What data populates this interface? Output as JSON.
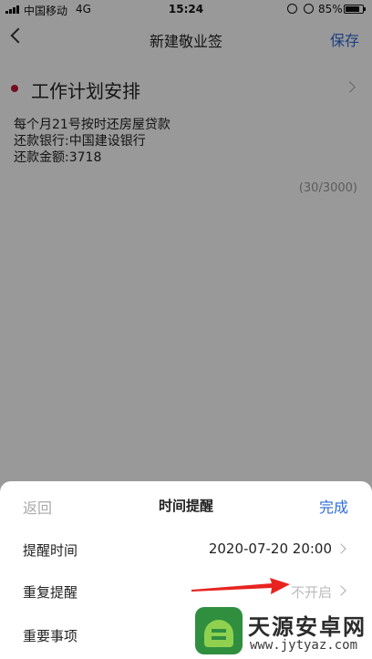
{
  "status_bar": {
    "carrier": "中国移动",
    "network": "4G",
    "time": "15:24",
    "battery": "85%",
    "battery_level": 0.85,
    "icons": [
      "signal-icon",
      "rotation-lock-icon",
      "alarm-icon",
      "battery-icon"
    ]
  },
  "nav": {
    "back_icon": "chevron-left-icon",
    "title": "新建敬业签",
    "save_label": "保存"
  },
  "note": {
    "title": "工作计划安排",
    "lines": [
      "每个月21号按时还房屋贷款",
      "还款银行:中国建设银行",
      "还款金额:3718"
    ],
    "counter": "(30/3000)"
  },
  "sheet": {
    "back_label": "返回",
    "title": "时间提醒",
    "done_label": "完成",
    "rows": [
      {
        "label": "提醒时间",
        "value": "2020-07-20 20:00"
      },
      {
        "label": "重复提醒",
        "value": "不开启"
      },
      {
        "label": "重要事项",
        "value": ""
      }
    ]
  },
  "watermark": {
    "name": "天源安卓网",
    "url": "www.jytyaz.com"
  },
  "colors": {
    "accent": "#2f6bd8",
    "title_dot": "#c0163a",
    "annotation_arrow": "#e8231f"
  }
}
